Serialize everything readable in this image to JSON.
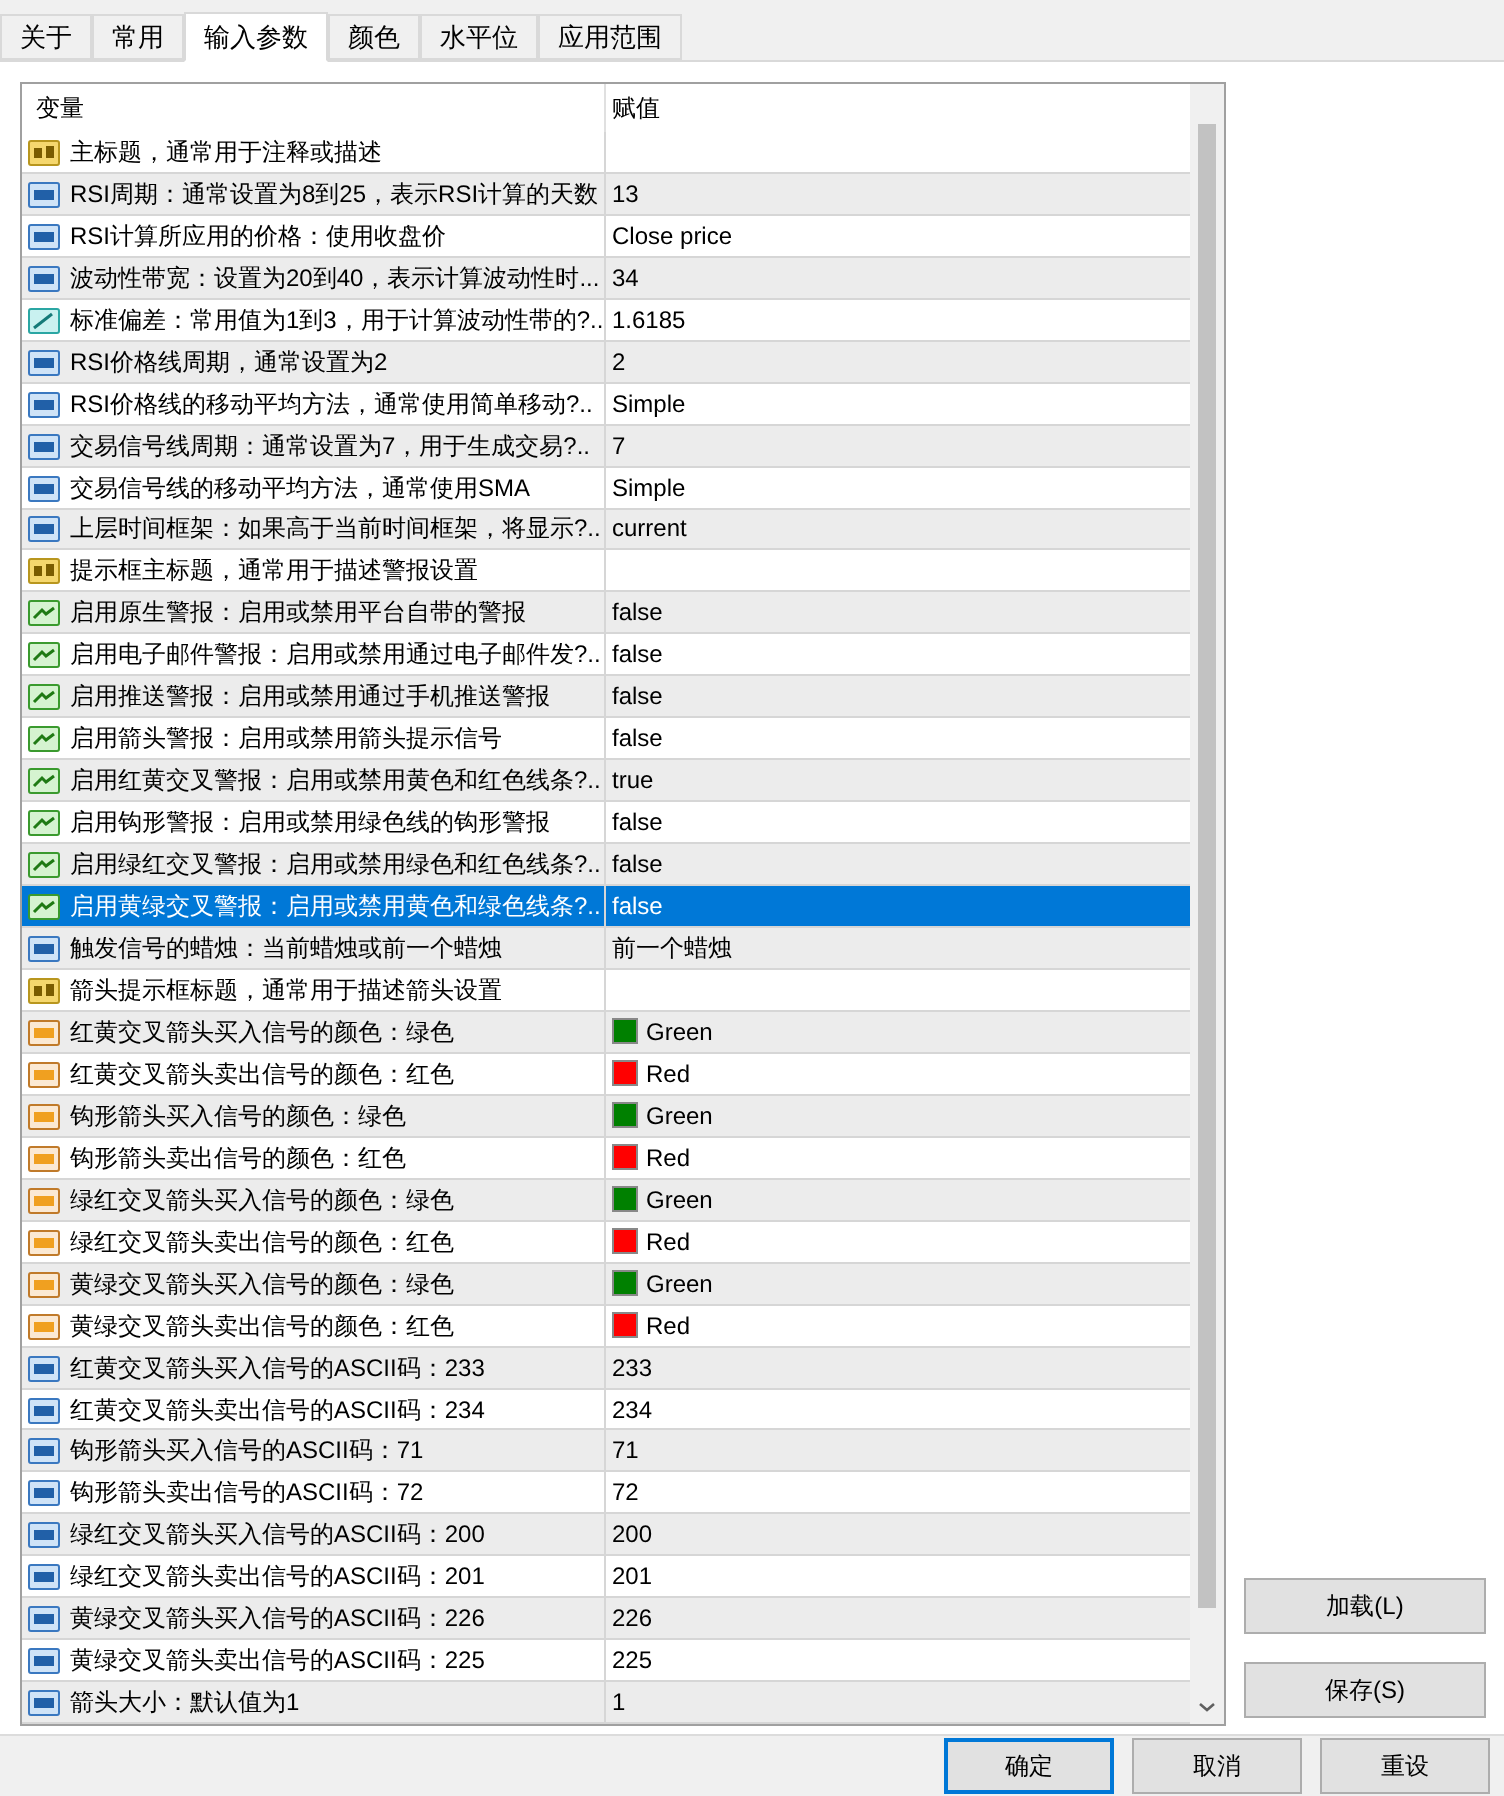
{
  "tabs": [
    {
      "label": "关于",
      "selected": false
    },
    {
      "label": "常用",
      "selected": false
    },
    {
      "label": "输入参数",
      "selected": true
    },
    {
      "label": "颜色",
      "selected": false
    },
    {
      "label": "水平位",
      "selected": false
    },
    {
      "label": "应用范围",
      "selected": false
    }
  ],
  "table": {
    "columns": [
      "变量",
      "赋值"
    ],
    "rows": [
      {
        "kind": "string",
        "label": "主标题，通常用于注释或描述",
        "value": "",
        "selected": false
      },
      {
        "kind": "int",
        "label": "RSI周期：通常设置为8到25，表示RSI计算的天数",
        "value": "13",
        "selected": false
      },
      {
        "kind": "int",
        "label": "RSI计算所应用的价格：使用收盘价",
        "value": "Close price",
        "selected": false
      },
      {
        "kind": "int",
        "label": "波动性带宽：设置为20到40，表示计算波动性时...",
        "value": "34",
        "selected": false
      },
      {
        "kind": "double",
        "label": "标准偏差：常用值为1到3，用于计算波动性带的?..",
        "value": "1.6185",
        "selected": false
      },
      {
        "kind": "int",
        "label": "RSI价格线周期，通常设置为2",
        "value": "2",
        "selected": false
      },
      {
        "kind": "int",
        "label": "RSI价格线的移动平均方法，通常使用简单移动?..",
        "value": "Simple",
        "selected": false
      },
      {
        "kind": "int",
        "label": "交易信号线周期：通常设置为7，用于生成交易?..",
        "value": "7",
        "selected": false
      },
      {
        "kind": "int",
        "label": "交易信号线的移动平均方法，通常使用SMA",
        "value": "Simple",
        "selected": false
      },
      {
        "kind": "int",
        "label": "上层时间框架：如果高于当前时间框架，将显示?..",
        "value": "current",
        "selected": false
      },
      {
        "kind": "string",
        "label": "提示框主标题，通常用于描述警报设置",
        "value": "",
        "selected": false
      },
      {
        "kind": "bool",
        "label": "启用原生警报：启用或禁用平台自带的警报",
        "value": "false",
        "selected": false
      },
      {
        "kind": "bool",
        "label": "启用电子邮件警报：启用或禁用通过电子邮件发?..",
        "value": "false",
        "selected": false
      },
      {
        "kind": "bool",
        "label": "启用推送警报：启用或禁用通过手机推送警报",
        "value": "false",
        "selected": false
      },
      {
        "kind": "bool",
        "label": "启用箭头警报：启用或禁用箭头提示信号",
        "value": "false",
        "selected": false
      },
      {
        "kind": "bool",
        "label": "启用红黄交叉警报：启用或禁用黄色和红色线条?..",
        "value": "true",
        "selected": false
      },
      {
        "kind": "bool",
        "label": "启用钩形警报：启用或禁用绿色线的钩形警报",
        "value": "false",
        "selected": false
      },
      {
        "kind": "bool",
        "label": "启用绿红交叉警报：启用或禁用绿色和红色线条?..",
        "value": "false",
        "selected": false
      },
      {
        "kind": "bool",
        "label": "启用黄绿交叉警报：启用或禁用黄色和绿色线条?..",
        "value": "false",
        "selected": true
      },
      {
        "kind": "int",
        "label": "触发信号的蜡烛：当前蜡烛或前一个蜡烛",
        "value": "前一个蜡烛",
        "selected": false
      },
      {
        "kind": "string",
        "label": "箭头提示框标题，通常用于描述箭头设置",
        "value": "",
        "selected": false
      },
      {
        "kind": "color",
        "label": "红黄交叉箭头买入信号的颜色：绿色",
        "value": "Green",
        "color": "#008000",
        "selected": false
      },
      {
        "kind": "color",
        "label": "红黄交叉箭头卖出信号的颜色：红色",
        "value": "Red",
        "color": "#ff0000",
        "selected": false
      },
      {
        "kind": "color",
        "label": "钩形箭头买入信号的颜色：绿色",
        "value": "Green",
        "color": "#008000",
        "selected": false
      },
      {
        "kind": "color",
        "label": "钩形箭头卖出信号的颜色：红色",
        "value": "Red",
        "color": "#ff0000",
        "selected": false
      },
      {
        "kind": "color",
        "label": "绿红交叉箭头买入信号的颜色：绿色",
        "value": "Green",
        "color": "#008000",
        "selected": false
      },
      {
        "kind": "color",
        "label": "绿红交叉箭头卖出信号的颜色：红色",
        "value": "Red",
        "color": "#ff0000",
        "selected": false
      },
      {
        "kind": "color",
        "label": "黄绿交叉箭头买入信号的颜色：绿色",
        "value": "Green",
        "color": "#008000",
        "selected": false
      },
      {
        "kind": "color",
        "label": "黄绿交叉箭头卖出信号的颜色：红色",
        "value": "Red",
        "color": "#ff0000",
        "selected": false
      },
      {
        "kind": "int",
        "label": "红黄交叉箭头买入信号的ASCII码：233",
        "value": "233",
        "selected": false
      },
      {
        "kind": "int",
        "label": "红黄交叉箭头卖出信号的ASCII码：234",
        "value": "234",
        "selected": false
      },
      {
        "kind": "int",
        "label": "钩形箭头买入信号的ASCII码：71",
        "value": "71",
        "selected": false
      },
      {
        "kind": "int",
        "label": "钩形箭头卖出信号的ASCII码：72",
        "value": "72",
        "selected": false
      },
      {
        "kind": "int",
        "label": "绿红交叉箭头买入信号的ASCII码：200",
        "value": "200",
        "selected": false
      },
      {
        "kind": "int",
        "label": "绿红交叉箭头卖出信号的ASCII码：201",
        "value": "201",
        "selected": false
      },
      {
        "kind": "int",
        "label": "黄绿交叉箭头买入信号的ASCII码：226",
        "value": "226",
        "selected": false
      },
      {
        "kind": "int",
        "label": "黄绿交叉箭头卖出信号的ASCII码：225",
        "value": "225",
        "selected": false
      },
      {
        "kind": "int",
        "label": "箭头大小：默认值为1",
        "value": "1",
        "selected": false
      }
    ]
  },
  "side_buttons": [
    "加载(L)",
    "保存(S)"
  ],
  "buttons": [
    {
      "label": "确定",
      "default": true
    },
    {
      "label": "取消",
      "default": false
    },
    {
      "label": "重设",
      "default": false
    }
  ]
}
